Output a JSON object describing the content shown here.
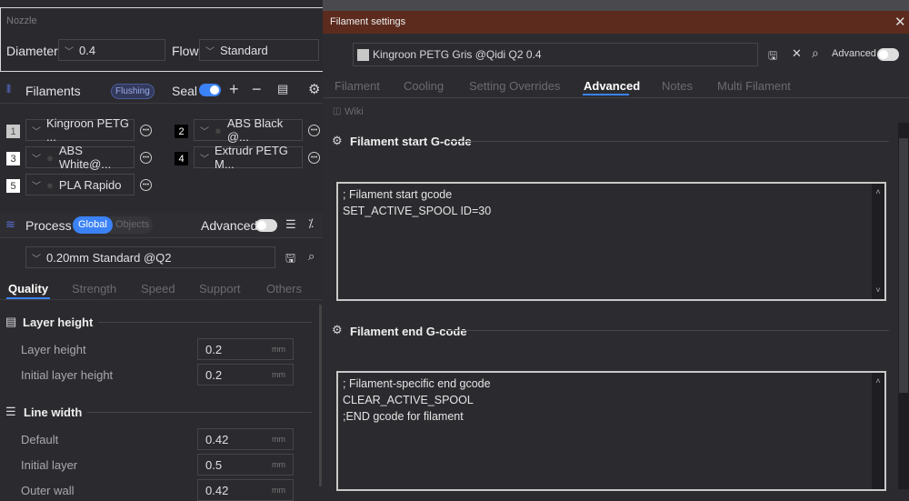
{
  "nozzle": {
    "title": "Nozzle",
    "diameter_label": "Diameter",
    "diameter_value": "0.4",
    "flow_label": "Flow",
    "flow_value": "Standard"
  },
  "filaments": {
    "title": "Filaments",
    "flushing": "Flushing",
    "seal": "Seal",
    "items": [
      {
        "num": "1",
        "name": "Kingroon PETG ...",
        "swatch": "#c8c8c8"
      },
      {
        "num": "2",
        "name": "ABS Black @...",
        "swatch": "#000000"
      },
      {
        "num": "3",
        "name": "ABS White@...",
        "swatch": "#ffffff"
      },
      {
        "num": "4",
        "name": "Extrudr PETG M...",
        "swatch": "#000000"
      },
      {
        "num": "5",
        "name": "PLA Rapido",
        "swatch": "#ffffff"
      }
    ]
  },
  "process": {
    "title": "Process",
    "global": "Global",
    "objects": "Objects",
    "advanced": "Advanced",
    "preset": "0.20mm Standard @Q2",
    "tabs": [
      "Quality",
      "Strength",
      "Speed",
      "Support",
      "Others"
    ],
    "sections": [
      {
        "title": "Layer height",
        "rows": [
          {
            "label": "Layer height",
            "value": "0.2",
            "unit": "mm"
          },
          {
            "label": "Initial layer height",
            "value": "0.2",
            "unit": "mm"
          }
        ]
      },
      {
        "title": "Line width",
        "rows": [
          {
            "label": "Default",
            "value": "0.42",
            "unit": "mm"
          },
          {
            "label": "Initial layer",
            "value": "0.5",
            "unit": "mm"
          },
          {
            "label": "Outer wall",
            "value": "0.42",
            "unit": "mm"
          }
        ]
      }
    ]
  },
  "dialog": {
    "title": "Filament settings",
    "preset": "Kingroon PETG Gris @Qidi Q2 0.4",
    "advanced": "Advanced",
    "tabs": [
      "Filament",
      "Cooling",
      "Setting Overrides",
      "Advanced",
      "Notes",
      "Multi Filament"
    ],
    "wiki": "Wiki",
    "start_title": "Filament start G-code",
    "start_code": "; Filament start gcode\nSET_ACTIVE_SPOOL ID=30",
    "end_title": "Filament end G-code",
    "end_code": "; Filament-specific end gcode\nCLEAR_ACTIVE_SPOOL\n;END gcode for filament"
  },
  "colors": {
    "accent": "#3b82f6",
    "titlebar": "#5c2b1e"
  }
}
